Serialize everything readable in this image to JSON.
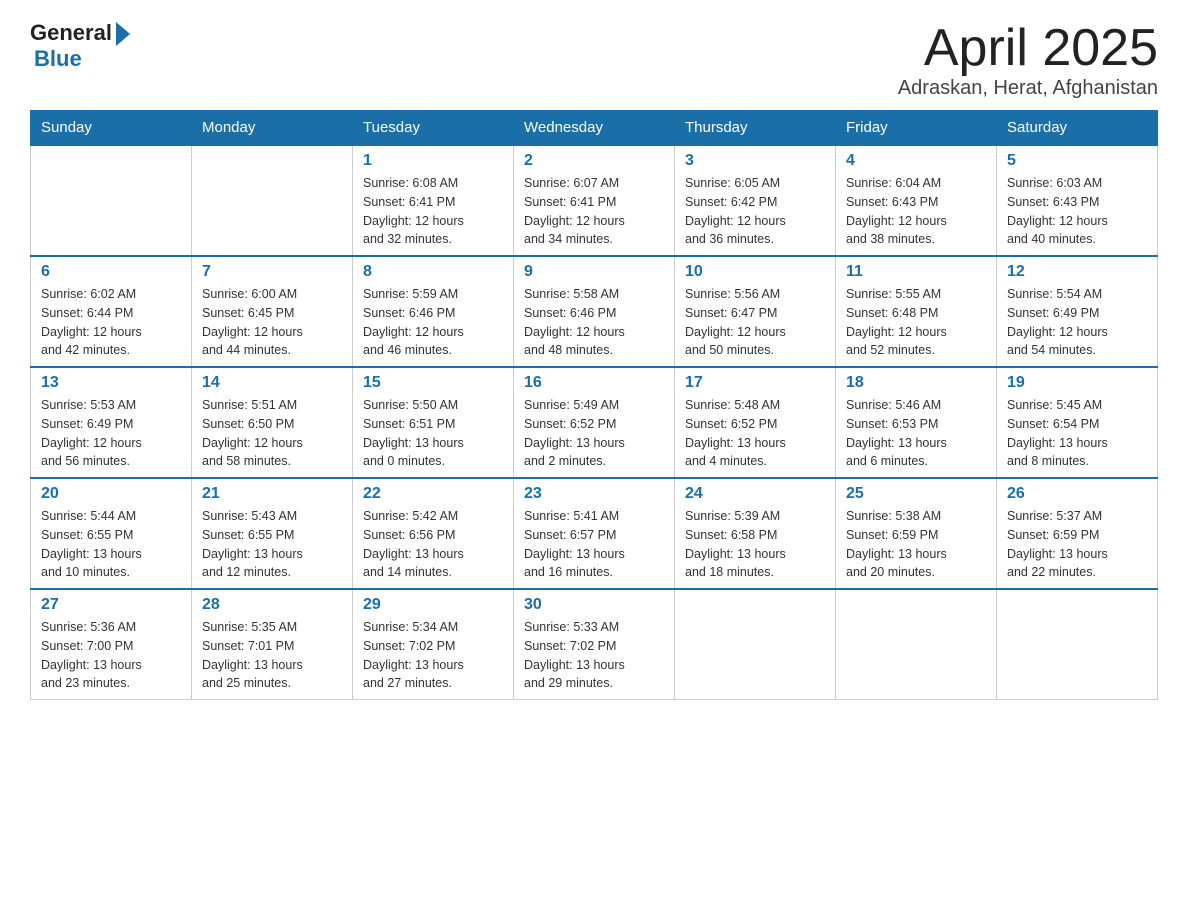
{
  "header": {
    "logo_general": "General",
    "logo_blue": "Blue",
    "title": "April 2025",
    "subtitle": "Adraskan, Herat, Afghanistan"
  },
  "calendar": {
    "days_of_week": [
      "Sunday",
      "Monday",
      "Tuesday",
      "Wednesday",
      "Thursday",
      "Friday",
      "Saturday"
    ],
    "weeks": [
      [
        {
          "day": "",
          "info": ""
        },
        {
          "day": "",
          "info": ""
        },
        {
          "day": "1",
          "info": "Sunrise: 6:08 AM\nSunset: 6:41 PM\nDaylight: 12 hours\nand 32 minutes."
        },
        {
          "day": "2",
          "info": "Sunrise: 6:07 AM\nSunset: 6:41 PM\nDaylight: 12 hours\nand 34 minutes."
        },
        {
          "day": "3",
          "info": "Sunrise: 6:05 AM\nSunset: 6:42 PM\nDaylight: 12 hours\nand 36 minutes."
        },
        {
          "day": "4",
          "info": "Sunrise: 6:04 AM\nSunset: 6:43 PM\nDaylight: 12 hours\nand 38 minutes."
        },
        {
          "day": "5",
          "info": "Sunrise: 6:03 AM\nSunset: 6:43 PM\nDaylight: 12 hours\nand 40 minutes."
        }
      ],
      [
        {
          "day": "6",
          "info": "Sunrise: 6:02 AM\nSunset: 6:44 PM\nDaylight: 12 hours\nand 42 minutes."
        },
        {
          "day": "7",
          "info": "Sunrise: 6:00 AM\nSunset: 6:45 PM\nDaylight: 12 hours\nand 44 minutes."
        },
        {
          "day": "8",
          "info": "Sunrise: 5:59 AM\nSunset: 6:46 PM\nDaylight: 12 hours\nand 46 minutes."
        },
        {
          "day": "9",
          "info": "Sunrise: 5:58 AM\nSunset: 6:46 PM\nDaylight: 12 hours\nand 48 minutes."
        },
        {
          "day": "10",
          "info": "Sunrise: 5:56 AM\nSunset: 6:47 PM\nDaylight: 12 hours\nand 50 minutes."
        },
        {
          "day": "11",
          "info": "Sunrise: 5:55 AM\nSunset: 6:48 PM\nDaylight: 12 hours\nand 52 minutes."
        },
        {
          "day": "12",
          "info": "Sunrise: 5:54 AM\nSunset: 6:49 PM\nDaylight: 12 hours\nand 54 minutes."
        }
      ],
      [
        {
          "day": "13",
          "info": "Sunrise: 5:53 AM\nSunset: 6:49 PM\nDaylight: 12 hours\nand 56 minutes."
        },
        {
          "day": "14",
          "info": "Sunrise: 5:51 AM\nSunset: 6:50 PM\nDaylight: 12 hours\nand 58 minutes."
        },
        {
          "day": "15",
          "info": "Sunrise: 5:50 AM\nSunset: 6:51 PM\nDaylight: 13 hours\nand 0 minutes."
        },
        {
          "day": "16",
          "info": "Sunrise: 5:49 AM\nSunset: 6:52 PM\nDaylight: 13 hours\nand 2 minutes."
        },
        {
          "day": "17",
          "info": "Sunrise: 5:48 AM\nSunset: 6:52 PM\nDaylight: 13 hours\nand 4 minutes."
        },
        {
          "day": "18",
          "info": "Sunrise: 5:46 AM\nSunset: 6:53 PM\nDaylight: 13 hours\nand 6 minutes."
        },
        {
          "day": "19",
          "info": "Sunrise: 5:45 AM\nSunset: 6:54 PM\nDaylight: 13 hours\nand 8 minutes."
        }
      ],
      [
        {
          "day": "20",
          "info": "Sunrise: 5:44 AM\nSunset: 6:55 PM\nDaylight: 13 hours\nand 10 minutes."
        },
        {
          "day": "21",
          "info": "Sunrise: 5:43 AM\nSunset: 6:55 PM\nDaylight: 13 hours\nand 12 minutes."
        },
        {
          "day": "22",
          "info": "Sunrise: 5:42 AM\nSunset: 6:56 PM\nDaylight: 13 hours\nand 14 minutes."
        },
        {
          "day": "23",
          "info": "Sunrise: 5:41 AM\nSunset: 6:57 PM\nDaylight: 13 hours\nand 16 minutes."
        },
        {
          "day": "24",
          "info": "Sunrise: 5:39 AM\nSunset: 6:58 PM\nDaylight: 13 hours\nand 18 minutes."
        },
        {
          "day": "25",
          "info": "Sunrise: 5:38 AM\nSunset: 6:59 PM\nDaylight: 13 hours\nand 20 minutes."
        },
        {
          "day": "26",
          "info": "Sunrise: 5:37 AM\nSunset: 6:59 PM\nDaylight: 13 hours\nand 22 minutes."
        }
      ],
      [
        {
          "day": "27",
          "info": "Sunrise: 5:36 AM\nSunset: 7:00 PM\nDaylight: 13 hours\nand 23 minutes."
        },
        {
          "day": "28",
          "info": "Sunrise: 5:35 AM\nSunset: 7:01 PM\nDaylight: 13 hours\nand 25 minutes."
        },
        {
          "day": "29",
          "info": "Sunrise: 5:34 AM\nSunset: 7:02 PM\nDaylight: 13 hours\nand 27 minutes."
        },
        {
          "day": "30",
          "info": "Sunrise: 5:33 AM\nSunset: 7:02 PM\nDaylight: 13 hours\nand 29 minutes."
        },
        {
          "day": "",
          "info": ""
        },
        {
          "day": "",
          "info": ""
        },
        {
          "day": "",
          "info": ""
        }
      ]
    ]
  }
}
